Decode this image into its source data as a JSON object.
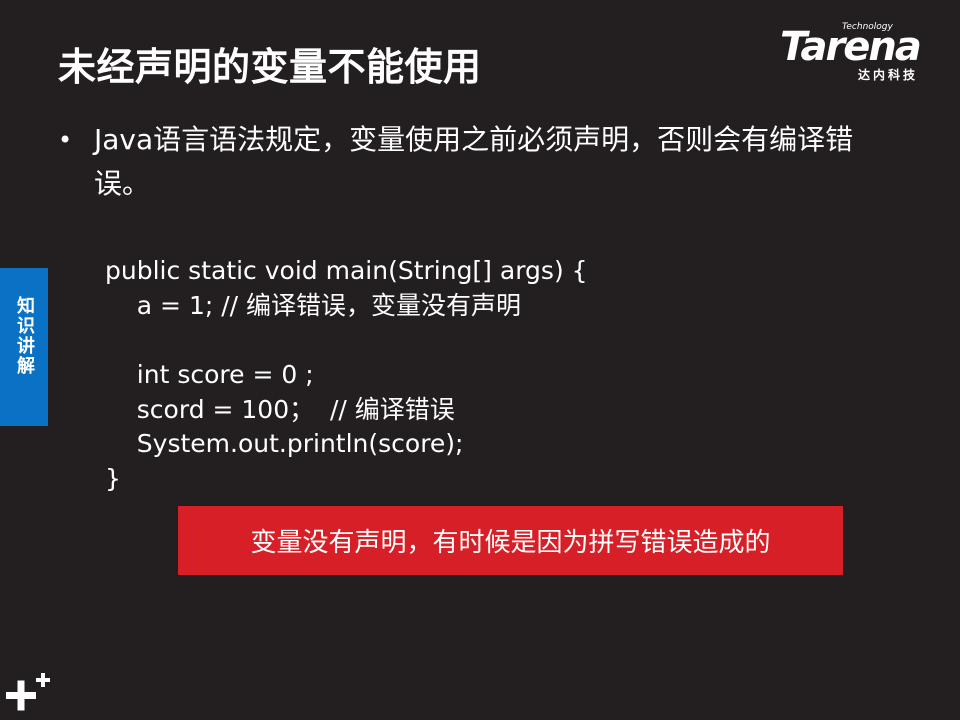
{
  "title": "未经声明的变量不能使用",
  "logo": {
    "small": "Technology",
    "word": "Tarena",
    "cn": "达内科技"
  },
  "bullet": "Java语言语法规定，变量使用之前必须声明，否则会有编译错误。",
  "code": [
    "public static void main(String[] args) {",
    "    a = 1; // 编译错误，变量没有声明",
    "",
    "    int score = 0 ;",
    "    scord = 100；  // 编译错误",
    "    System.out.println(score);",
    "}"
  ],
  "side_tab": "知识讲解",
  "callout": "变量没有声明，有时候是因为拼写错误造成的",
  "colors": {
    "background": "#231f20",
    "side_tab": "#0a72c4",
    "callout": "#d71f27"
  }
}
